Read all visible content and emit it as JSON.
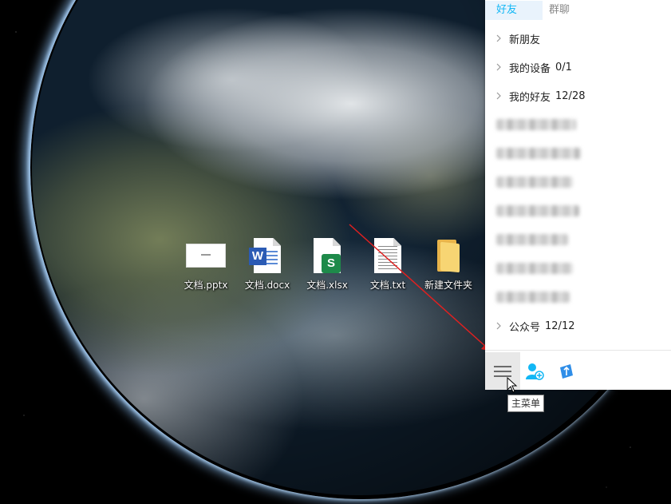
{
  "desktop": {
    "icons": [
      {
        "label": "文档.pptx",
        "type": "pptx-file-icon"
      },
      {
        "label": "文档.docx",
        "type": "word-file-icon",
        "badge": "W"
      },
      {
        "label": "文档.xlsx",
        "type": "excel-file-icon",
        "badge": "S"
      },
      {
        "label": "文档.txt",
        "type": "text-file-icon"
      },
      {
        "label": "新建文件夹",
        "type": "folder-icon"
      }
    ]
  },
  "qq_panel": {
    "tabs": [
      {
        "label": "好友",
        "active": true
      },
      {
        "label": "群聊",
        "active": false
      }
    ],
    "groups_top": [
      {
        "name": "新朋友",
        "count": ""
      },
      {
        "name": "我的设备",
        "count": "0/1"
      },
      {
        "name": "我的好友",
        "count": "12/28"
      }
    ],
    "groups_bottom": [
      {
        "name": "公众号",
        "count": "12/12"
      }
    ],
    "toolbar": {
      "menu_icon": "hamburger-menu-icon",
      "add_friend_icon": "add-friend-icon",
      "app_icon": "app-manager-icon"
    },
    "tooltip": "主菜单"
  },
  "colors": {
    "accent": "#12b7f5",
    "active_tab_bg": "#e9f3fc",
    "annotation_arrow": "#e02020",
    "word_blue": "#2b5bb4",
    "excel_green": "#1e8a4a",
    "folder_yellow": "#f7d573"
  }
}
